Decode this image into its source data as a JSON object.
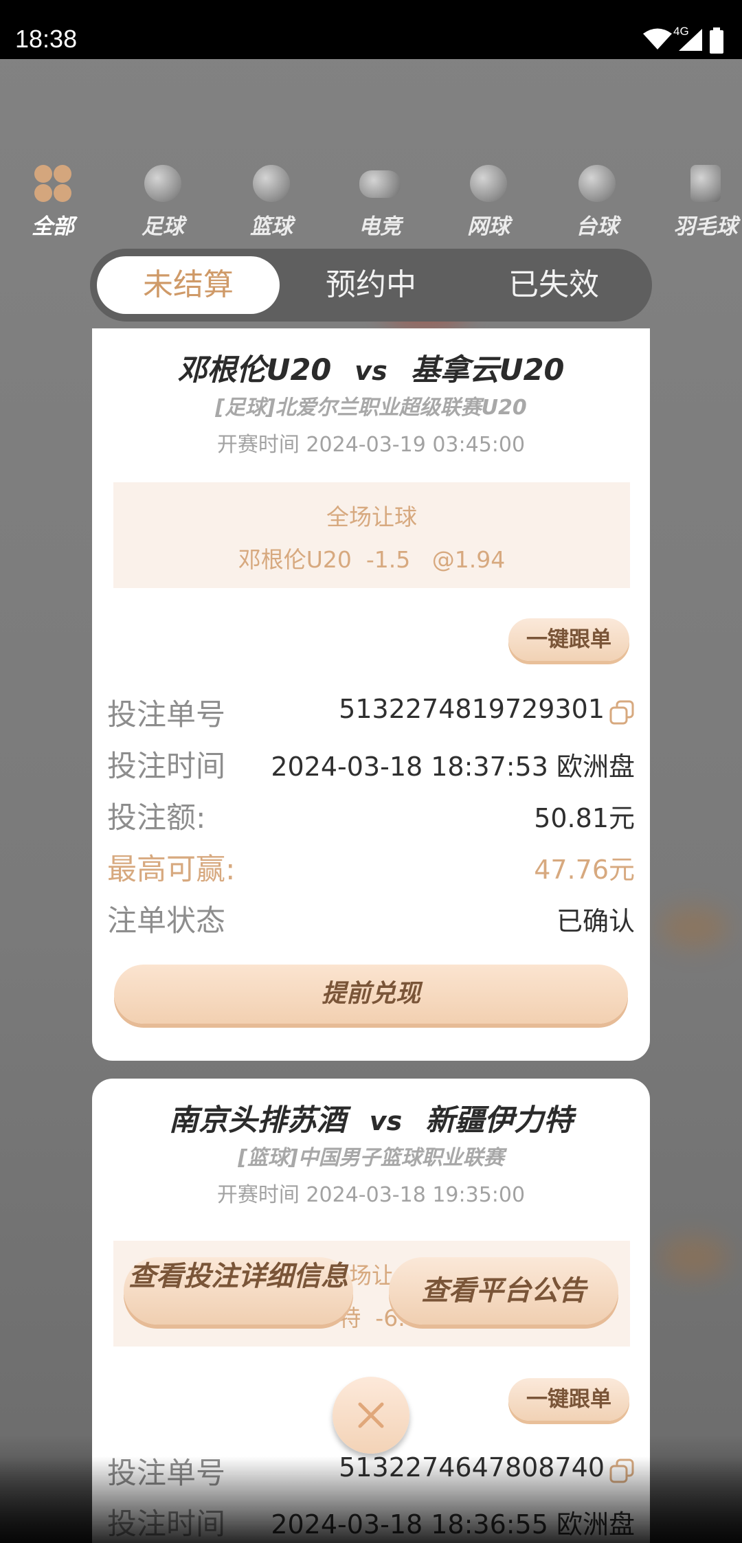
{
  "status_bar": {
    "time": "18:38",
    "network": "4G"
  },
  "categories": [
    {
      "label": "全部",
      "icon": "clover-icon",
      "active": true
    },
    {
      "label": "足球",
      "icon": "football-icon"
    },
    {
      "label": "篮球",
      "icon": "basketball-icon"
    },
    {
      "label": "电竞",
      "icon": "gamepad-icon"
    },
    {
      "label": "网球",
      "icon": "tennis-icon"
    },
    {
      "label": "台球",
      "icon": "billiards-icon"
    },
    {
      "label": "羽毛球",
      "icon": "badminton-icon"
    }
  ],
  "tabs": [
    {
      "label": "未结算",
      "active": true
    },
    {
      "label": "预约中"
    },
    {
      "label": "已失效"
    }
  ],
  "bets": [
    {
      "home": "邓根伦U20",
      "vs": "vs",
      "away": "基拿云U20",
      "league": "[足球]北爱尔兰职业超级联赛U20",
      "kickoff_label": "开赛时间 2024-03-19 03:45:00",
      "market": "全场让球",
      "selection": "邓根伦U20  -1.5   @1.94",
      "follow_label": "一键跟单",
      "order_no_label": "投注单号",
      "order_no": "5132274819729301",
      "bet_time_label": "投注时间",
      "bet_time": "2024-03-18 18:37:53 欧洲盘",
      "amount_label": "投注额:",
      "amount": "50.81元",
      "max_win_label": "最高可赢:",
      "max_win": "47.76元",
      "status_label": "注单状态",
      "status": "已确认",
      "cashout_label": "提前兑现"
    },
    {
      "home": "南京头排苏酒",
      "vs": "vs",
      "away": "新疆伊力特",
      "league": "[篮球]中国男子篮球职业联赛",
      "kickoff_label": "开赛时间 2024-03-18 19:35:00",
      "market_partial": "场让",
      "selection_partial": "特  -6.",
      "follow_label": "一键跟单",
      "order_no_label": "投注单号",
      "order_no": "5132274647808740",
      "bet_time_label": "投注时间",
      "bet_time": "2024-03-18 18:36:55 欧洲盘"
    }
  ],
  "overlay": {
    "detail_button": "查看投注详细信息",
    "notice_button": "查看平台公告"
  },
  "colors": {
    "accent": "#cf9a68",
    "gold_text": "#d7a97f",
    "card_bg": "#ffffff"
  }
}
